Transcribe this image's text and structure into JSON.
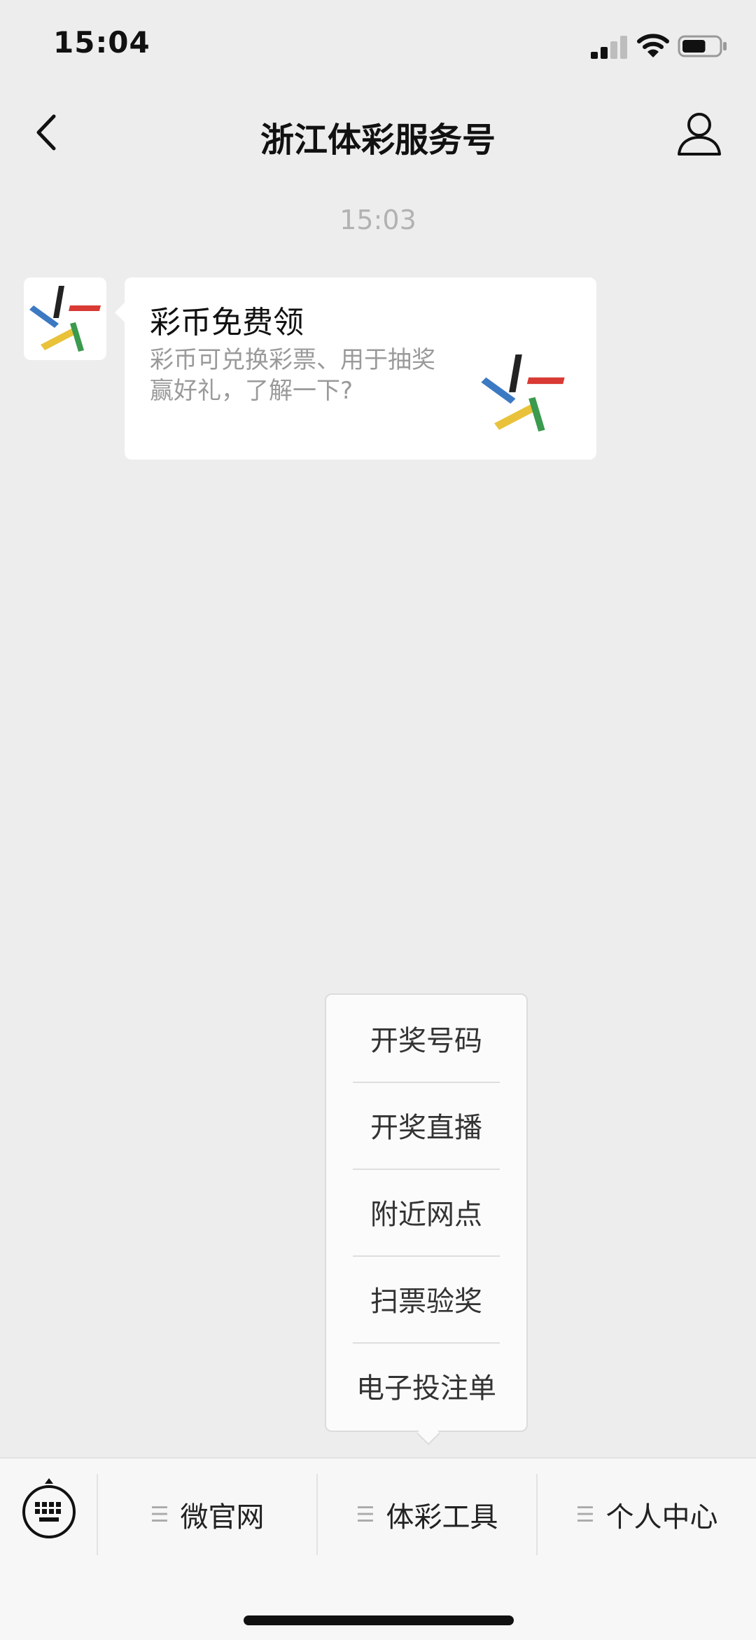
{
  "status_bar": {
    "time": "15:04",
    "battery_level": 0.65
  },
  "nav": {
    "title": "浙江体彩服务号"
  },
  "chat": {
    "timestamp": "15:03",
    "card": {
      "title": "彩币免费领",
      "description": "彩币可兑换彩票、用于抽奖赢好礼，了解一下?"
    }
  },
  "popup": {
    "items": [
      "开奖号码",
      "开奖直播",
      "附近网点",
      "扫票验奖",
      "电子投注单"
    ]
  },
  "menu": {
    "tabs": [
      {
        "label": "微官网",
        "icon": "menu-lines-icon"
      },
      {
        "label": "体彩工具",
        "icon": "menu-lines-icon"
      },
      {
        "label": "个人中心",
        "icon": "menu-lines-icon"
      }
    ]
  },
  "colors": {
    "logo_black": "#222222",
    "logo_red": "#d93a34",
    "logo_blue": "#3c79c3",
    "logo_yellow": "#e9c23a",
    "logo_green": "#3a9a4e"
  }
}
